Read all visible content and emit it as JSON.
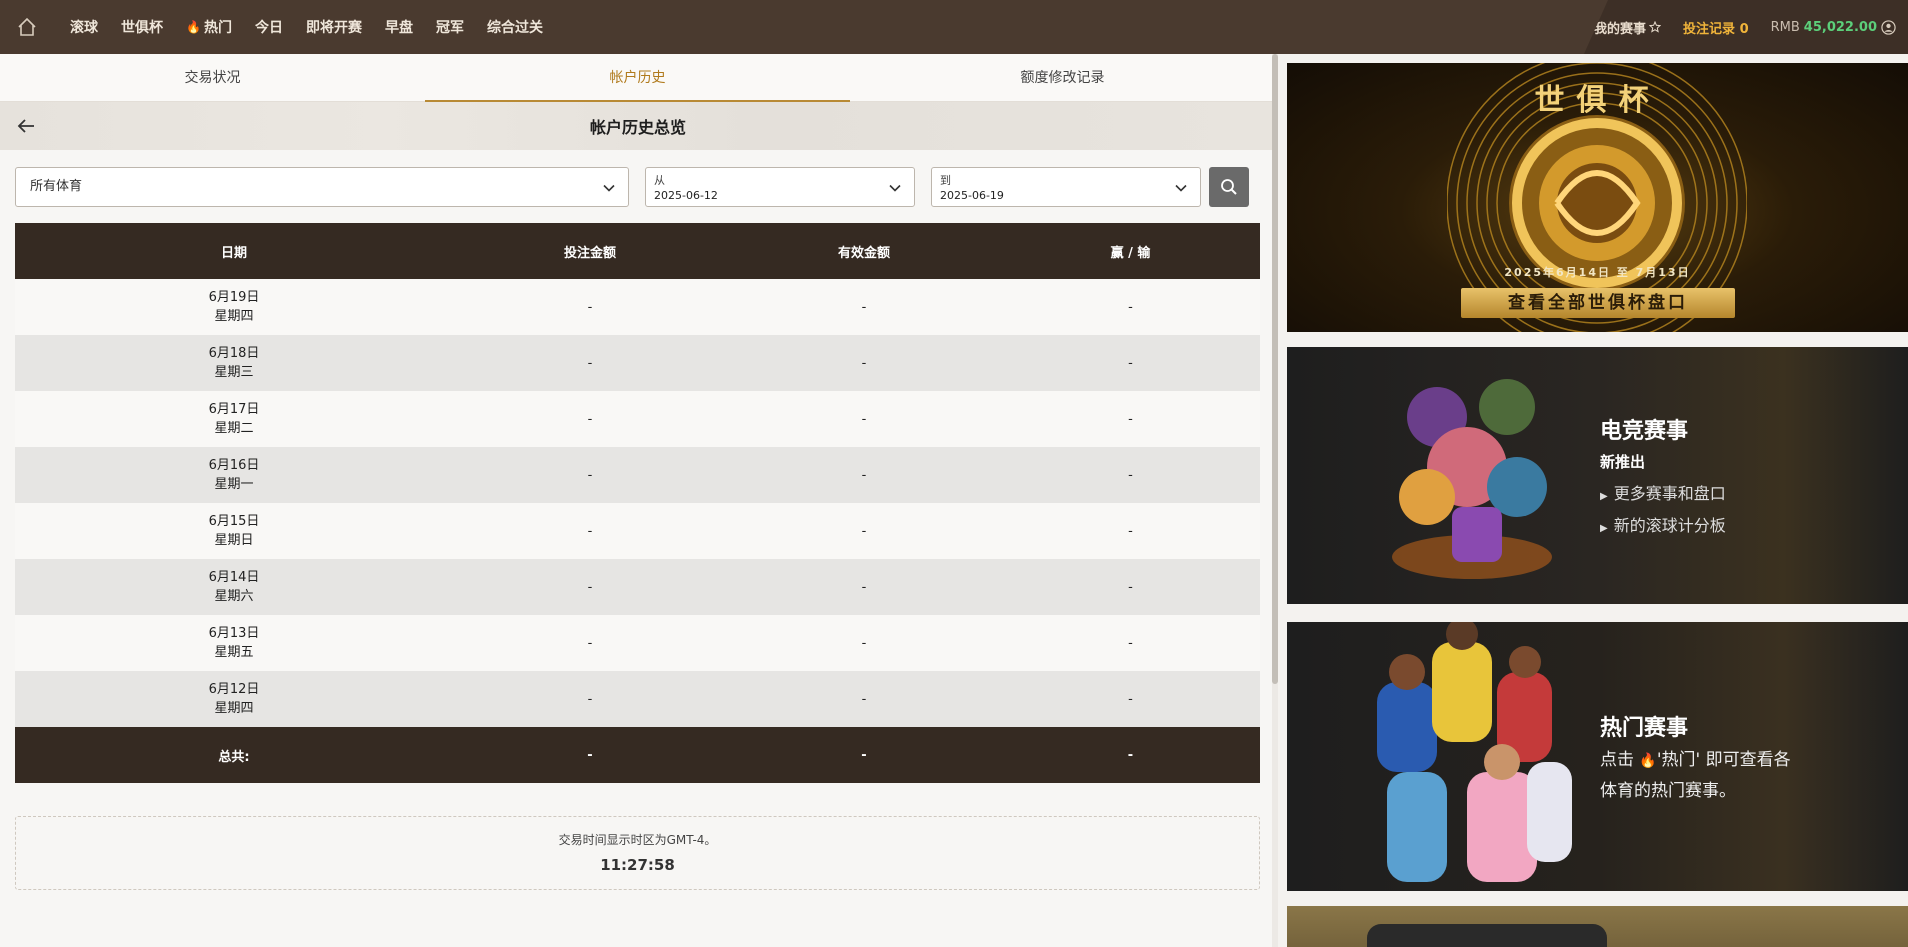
{
  "topbar": {
    "nav": [
      {
        "label": "滚球"
      },
      {
        "label": "世俱杯"
      },
      {
        "label": "热门",
        "hot": true
      },
      {
        "label": "今日"
      },
      {
        "label": "即将开赛"
      },
      {
        "label": "早盘"
      },
      {
        "label": "冠军"
      },
      {
        "label": "综合过关"
      }
    ],
    "my_events": "我的赛事",
    "bet_record": "投注记录 0",
    "currency": "RMB",
    "balance": "45,022.00"
  },
  "tabs": [
    {
      "label": "交易状况"
    },
    {
      "label": "帐户历史",
      "active": true
    },
    {
      "label": "额度修改记录"
    }
  ],
  "page_title": "帐户历史总览",
  "filters": {
    "sport": "所有体育",
    "from_label": "从",
    "from_value": "2025-06-12",
    "to_label": "到",
    "to_value": "2025-06-19"
  },
  "table": {
    "headers": [
      "日期",
      "投注金额",
      "有效金额",
      "赢 / 输"
    ],
    "rows": [
      {
        "date": "6月19日",
        "weekday": "星期四",
        "bet": "-",
        "valid": "-",
        "winloss": "-"
      },
      {
        "date": "6月18日",
        "weekday": "星期三",
        "bet": "-",
        "valid": "-",
        "winloss": "-"
      },
      {
        "date": "6月17日",
        "weekday": "星期二",
        "bet": "-",
        "valid": "-",
        "winloss": "-"
      },
      {
        "date": "6月16日",
        "weekday": "星期一",
        "bet": "-",
        "valid": "-",
        "winloss": "-"
      },
      {
        "date": "6月15日",
        "weekday": "星期日",
        "bet": "-",
        "valid": "-",
        "winloss": "-"
      },
      {
        "date": "6月14日",
        "weekday": "星期六",
        "bet": "-",
        "valid": "-",
        "winloss": "-"
      },
      {
        "date": "6月13日",
        "weekday": "星期五",
        "bet": "-",
        "valid": "-",
        "winloss": "-"
      },
      {
        "date": "6月12日",
        "weekday": "星期四",
        "bet": "-",
        "valid": "-",
        "winloss": "-"
      }
    ],
    "footer": {
      "label": "总共:",
      "bet": "-",
      "valid": "-",
      "winloss": "-"
    }
  },
  "timezone": {
    "note": "交易时间显示时区为GMT-4。",
    "time": "11:27:58"
  },
  "banners": {
    "worldcup": {
      "title": "世俱杯",
      "date": "2025年6月14日 至 7月13日",
      "button": "查看全部世俱杯盘口"
    },
    "esports": {
      "title": "电竞赛事",
      "subtitle": "新推出",
      "lines": [
        "更多赛事和盘口",
        "新的滚球计分板"
      ]
    },
    "hot": {
      "title": "热门赛事",
      "line1_a": "点击",
      "line1_b": "'热门' 即可查看各",
      "line2": "体育的热门赛事。"
    }
  },
  "colors": {
    "topbar": "#4a3a2f",
    "accent": "#b88a35",
    "table_header": "#352a22",
    "balance": "#5ccf7a",
    "bet_record": "#f0b43a"
  }
}
